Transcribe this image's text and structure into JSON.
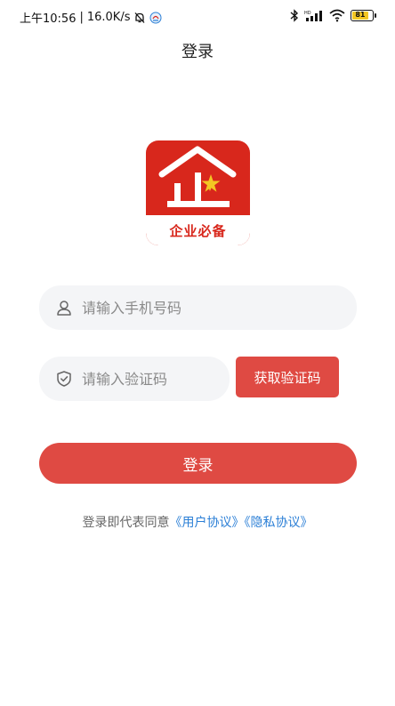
{
  "status_bar": {
    "time": "上午10:56",
    "speed": "16.0K/s",
    "battery_level": 81,
    "battery_label": "81",
    "battery_color": "#f3c623"
  },
  "header": {
    "title": "登录"
  },
  "logo": {
    "text": "企业必备",
    "brand_color": "#d8271c"
  },
  "form": {
    "phone_placeholder": "请输入手机号码",
    "phone_value": "",
    "code_placeholder": "请输入验证码",
    "code_value": "",
    "get_code_label": "获取验证码",
    "login_label": "登录",
    "accent_color": "#df4a43"
  },
  "agreement": {
    "prefix": "登录即代表同意",
    "user_agreement": "《用户协议》",
    "privacy_agreement": "《隐私协议》",
    "link_color": "#2b7fd6"
  }
}
